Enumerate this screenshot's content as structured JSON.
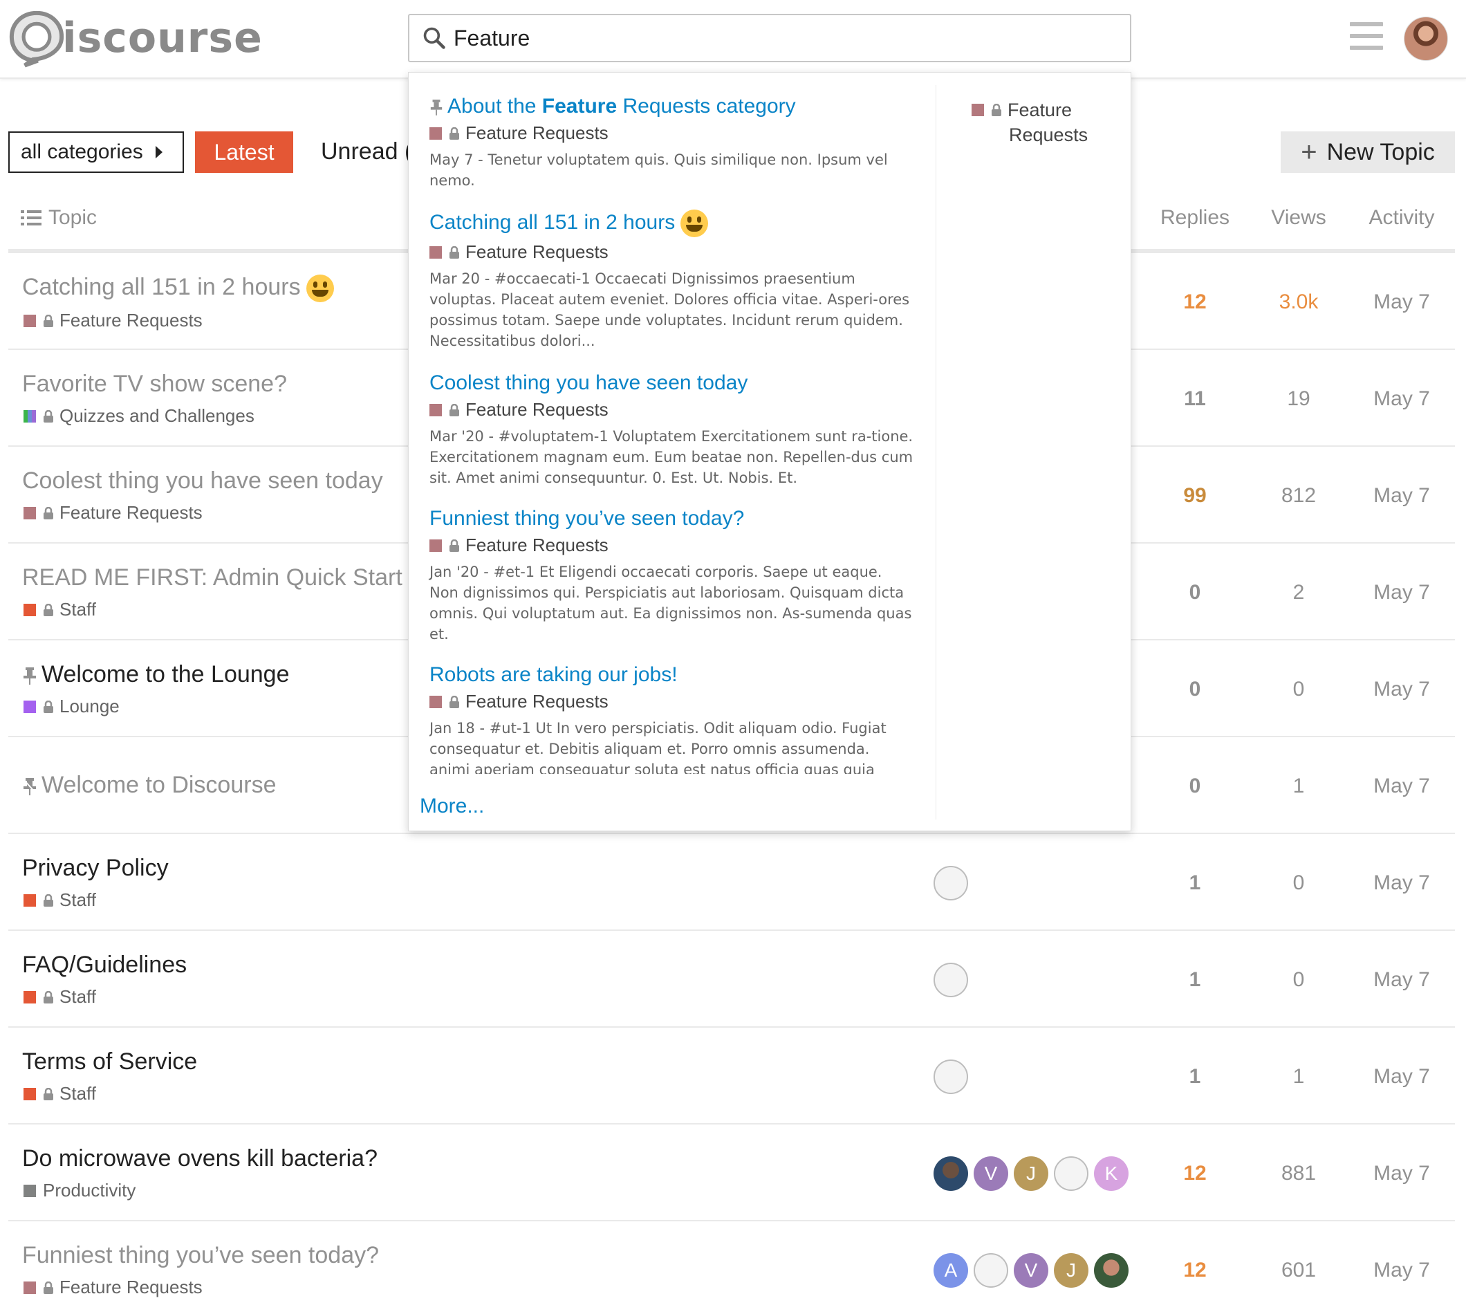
{
  "brand": {
    "name": "iscourse"
  },
  "search": {
    "value": "Feature"
  },
  "nav": {
    "categories_label": "all categories",
    "latest_label": "Latest",
    "unread_label": "Unread (",
    "new_topic_label": "New Topic"
  },
  "table_header": {
    "topic": "Topic",
    "replies": "Replies",
    "views": "Views",
    "activity": "Activity"
  },
  "topics": [
    {
      "title": "Catching all 151 in 2 hours",
      "category": "Feature Requests",
      "replies": "12",
      "views": "3.0k",
      "activity": "May 7"
    },
    {
      "title": "Favorite TV show scene?",
      "category": "Quizzes and Challenges",
      "replies": "11",
      "views": "19",
      "activity": "May 7"
    },
    {
      "title": "Coolest thing you have seen today",
      "category": "Feature Requests",
      "replies": "99",
      "views": "812",
      "activity": "May 7"
    },
    {
      "title": "READ ME FIRST: Admin Quick Start (",
      "category": "Staff",
      "replies": "0",
      "views": "2",
      "activity": "May 7"
    },
    {
      "title": "Welcome to the Lounge",
      "category": "Lounge",
      "replies": "0",
      "views": "0",
      "activity": "May 7"
    },
    {
      "title": "Welcome to Discourse",
      "category": "",
      "replies": "0",
      "views": "1",
      "activity": "May 7"
    },
    {
      "title": "Privacy Policy",
      "category": "Staff",
      "replies": "1",
      "views": "0",
      "activity": "May 7"
    },
    {
      "title": "FAQ/Guidelines",
      "category": "Staff",
      "replies": "1",
      "views": "0",
      "activity": "May 7"
    },
    {
      "title": "Terms of Service",
      "category": "Staff",
      "replies": "1",
      "views": "1",
      "activity": "May 7"
    },
    {
      "title": "Do microwave ovens kill bacteria?",
      "category": "Productivity",
      "replies": "12",
      "views": "881",
      "activity": "May 7",
      "posters": [
        "",
        "V",
        "J",
        "",
        "K"
      ]
    },
    {
      "title": "Funniest thing you’ve seen today?",
      "category": "Feature Requests",
      "replies": "12",
      "views": "601",
      "activity": "May 7",
      "posters": [
        "A",
        "",
        "V",
        "J",
        ""
      ]
    }
  ],
  "search_results": [
    {
      "title_pre": "About the ",
      "title_hl": "Feature",
      "title_post": " Requests category",
      "category": "Feature Requests",
      "blurb": "May 7 - Tenetur voluptatem quis. Quis similique non. Ipsum vel nemo."
    },
    {
      "title": "Catching all 151 in 2 hours",
      "category": "Feature Requests",
      "blurb": "Mar 20 - #occaecati-1 Occaecati Dignissimos praesentium voluptas. Placeat autem eveniet. Dolores officia vitae. Asperi-ores possimus totam. Saepe unde voluptates. Incidunt rerum quidem. Necessitatibus dolori..."
    },
    {
      "title": "Coolest thing you have seen today",
      "category": "Feature Requests",
      "blurb": "Mar '20 - #voluptatem-1 Voluptatem Exercitationem sunt ra-tione. Exercitationem magnam eum. Eum beatae non. Repellen-dus cum sit. Amet animi consequuntur. 0. Est. Ut. Nobis. Et."
    },
    {
      "title": "Funniest thing you’ve seen today?",
      "category": "Feature Requests",
      "blurb": "Jan '20 - #et-1 Et Eligendi occaecati corporis. Saepe ut eaque. Non dignissimos qui. Perspiciatis aut laboriosam. Quisquam dicta omnis. Qui voluptatum aut. Ea dignissimos non. As-sumenda quas et."
    },
    {
      "title": "Robots are taking our jobs!",
      "category": "Feature Requests",
      "blurb": "Jan 18 - #ut-1 Ut In vero perspiciatis. Odit aliquam odio. Fugiat consequatur et. Debitis aliquam et. Porro omnis assumenda. animi aperiam consequatur soluta est natus officia quas quia"
    }
  ],
  "search_more": "More...",
  "search_category": {
    "line1": "Feature",
    "line2": "Requests"
  },
  "colors": {
    "accent": "#e45735",
    "link": "#0a84c7",
    "feature_requests": "#b3787d",
    "staff": "#e45735",
    "lounge": "#a461ef",
    "productivity": "#808281",
    "hot_orange": "#e98d3f",
    "warm_orange": "#c98b3b"
  }
}
